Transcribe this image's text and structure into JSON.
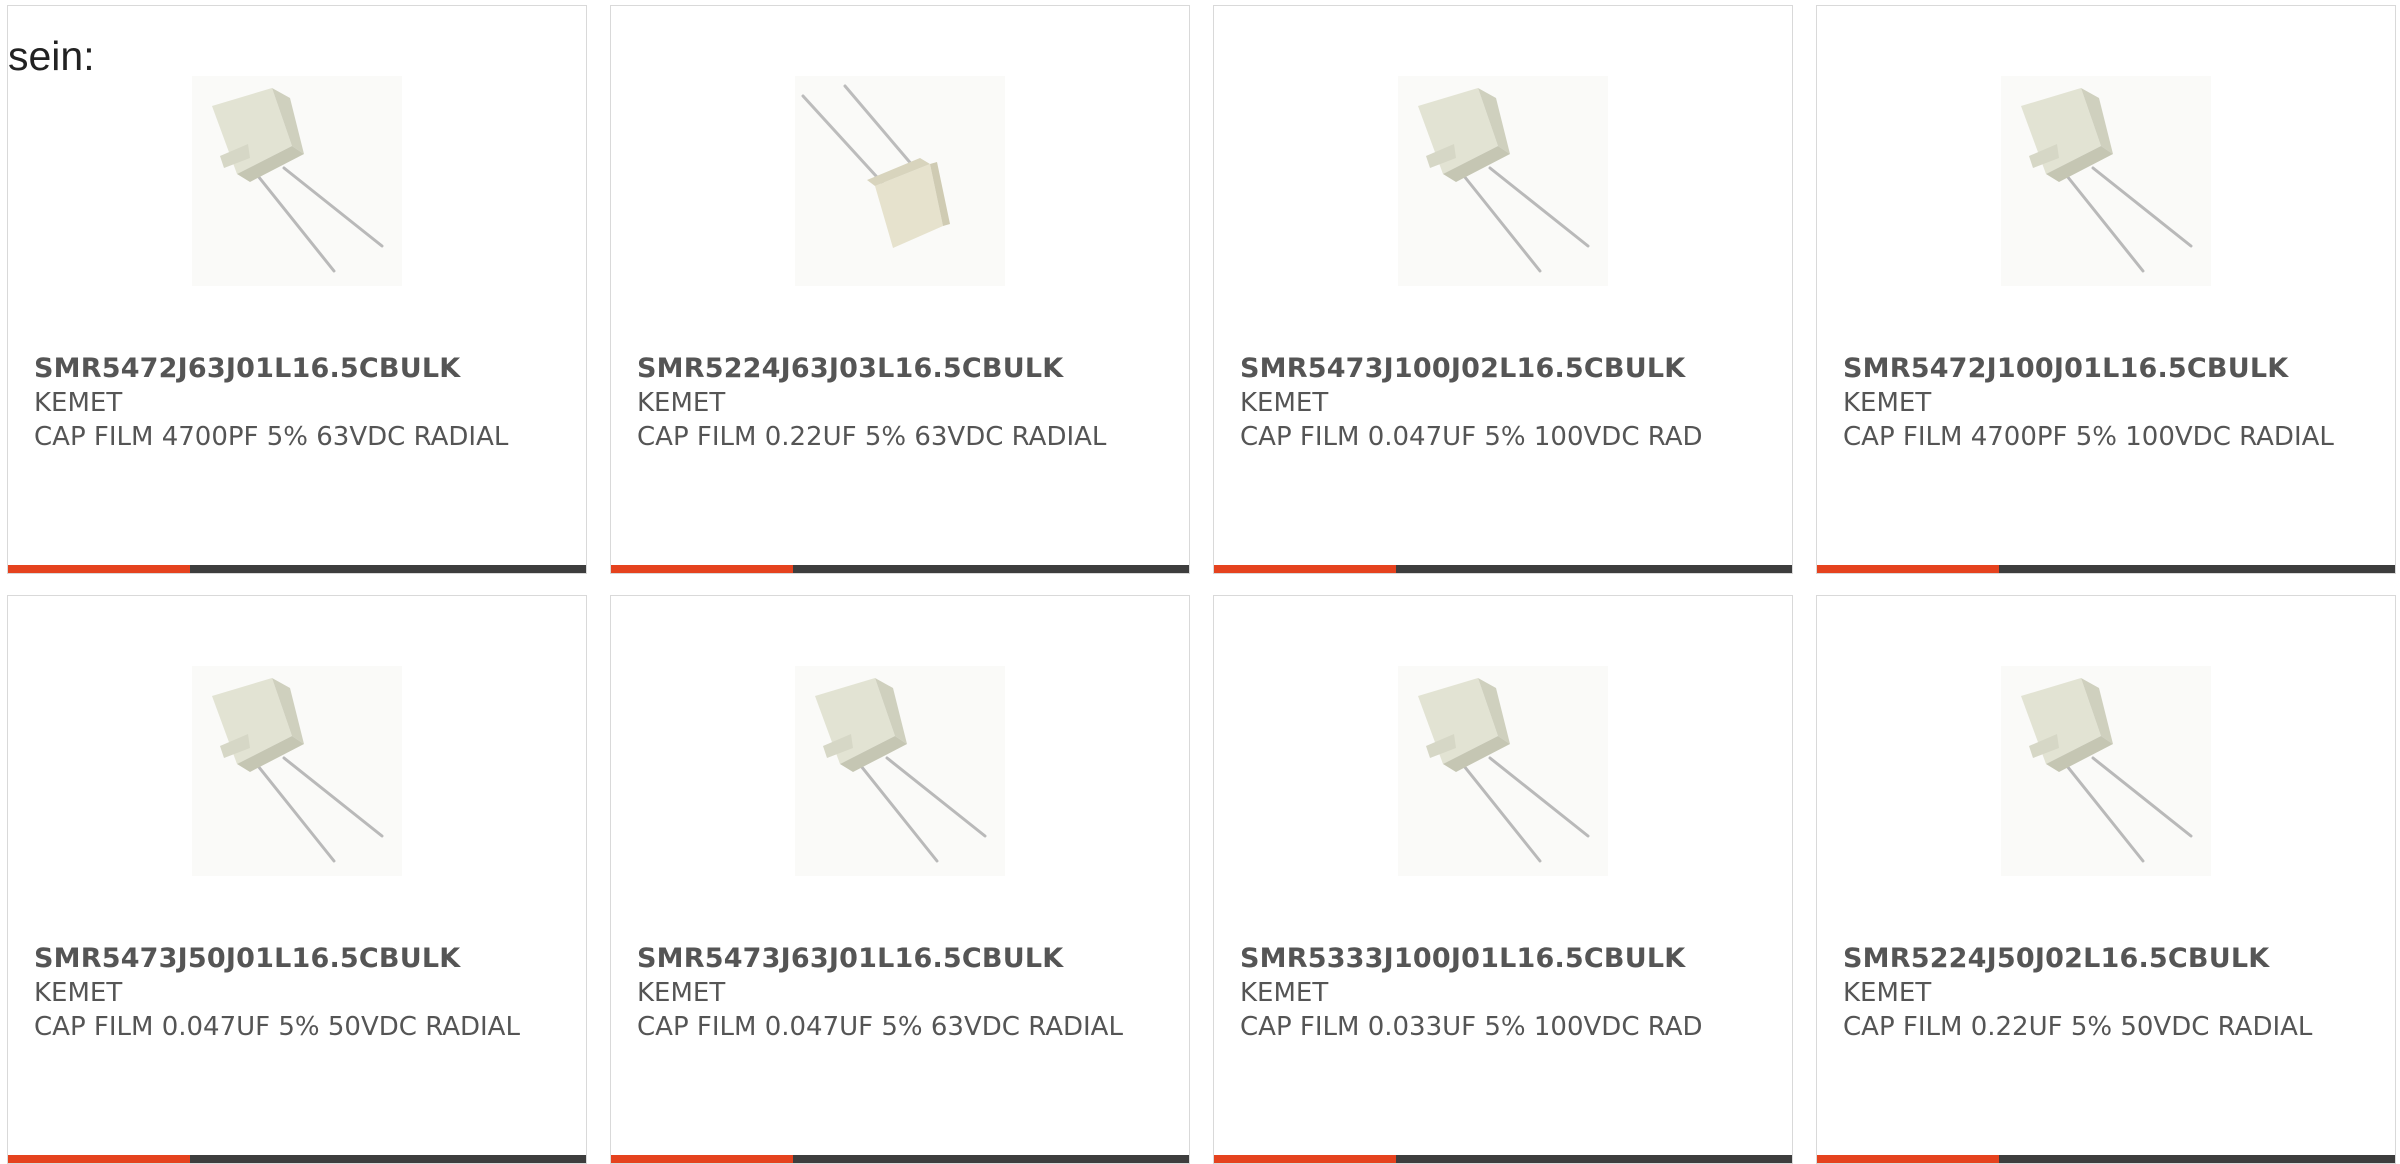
{
  "intro_text": "sein:",
  "colors": {
    "accent": "#e5421e",
    "bar": "#3d3d3d",
    "text": "#555555",
    "card_border": "#d9d9d9"
  },
  "products": [
    {
      "part_number": "SMR5472J63J01L16.5CBULK",
      "manufacturer": "KEMET",
      "description": "CAP FILM 4700PF 5% 63VDC RADIAL",
      "image": "capacitor-icon"
    },
    {
      "part_number": "SMR5224J63J03L16.5CBULK",
      "manufacturer": "KEMET",
      "description": "CAP FILM 0.22UF 5% 63VDC RADIAL",
      "image": "capacitor-icon"
    },
    {
      "part_number": "SMR5473J100J02L16.5CBULK",
      "manufacturer": "KEMET",
      "description": "CAP FILM 0.047UF 5% 100VDC RAD",
      "image": "capacitor-icon"
    },
    {
      "part_number": "SMR5472J100J01L16.5CBULK",
      "manufacturer": "KEMET",
      "description": "CAP FILM 4700PF 5% 100VDC RADIAL",
      "image": "capacitor-icon"
    },
    {
      "part_number": "SMR5473J50J01L16.5CBULK",
      "manufacturer": "KEMET",
      "description": "CAP FILM 0.047UF 5% 50VDC RADIAL",
      "image": "capacitor-icon"
    },
    {
      "part_number": "SMR5473J63J01L16.5CBULK",
      "manufacturer": "KEMET",
      "description": "CAP FILM 0.047UF 5% 63VDC RADIAL",
      "image": "capacitor-icon"
    },
    {
      "part_number": "SMR5333J100J01L16.5CBULK",
      "manufacturer": "KEMET",
      "description": "CAP FILM 0.033UF 5% 100VDC RAD",
      "image": "capacitor-icon"
    },
    {
      "part_number": "SMR5224J50J02L16.5CBULK",
      "manufacturer": "KEMET",
      "description": "CAP FILM 0.22UF 5% 50VDC RADIAL",
      "image": "capacitor-icon"
    }
  ]
}
